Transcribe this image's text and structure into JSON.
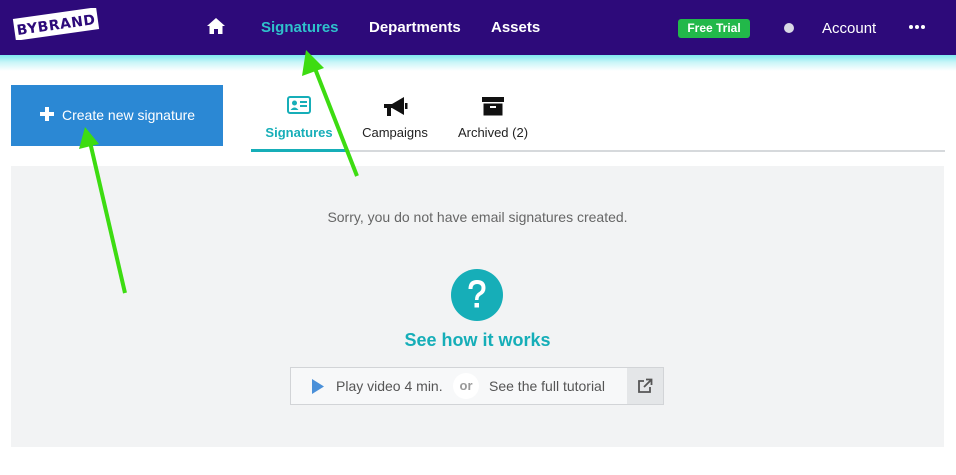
{
  "header": {
    "logo_text": "BYBRAND",
    "nav": [
      {
        "label": "Signatures",
        "active": true
      },
      {
        "label": "Departments",
        "active": false
      },
      {
        "label": "Assets",
        "active": false
      }
    ],
    "trial_badge": "Free Trial",
    "account_label": "Account"
  },
  "toolbar": {
    "create_label": "Create new signature"
  },
  "tabs": [
    {
      "label": "Signatures",
      "icon": "id-card-icon",
      "active": true
    },
    {
      "label": "Campaigns",
      "icon": "megaphone-icon",
      "active": false
    },
    {
      "label": "Archived (2)",
      "icon": "archive-box-icon",
      "active": false
    }
  ],
  "empty_state": {
    "message": "Sorry, you do not have email signatures created.",
    "how_title": "See how it works",
    "play_label": "Play video 4 min.",
    "or_label": "or",
    "tutorial_label": "See the full tutorial"
  },
  "colors": {
    "topbar": "#2d0a7a",
    "accent": "#16aeb8",
    "primary_button": "#2b88d4",
    "badge": "#22b84a",
    "annotation_arrow": "#3ddc11"
  }
}
